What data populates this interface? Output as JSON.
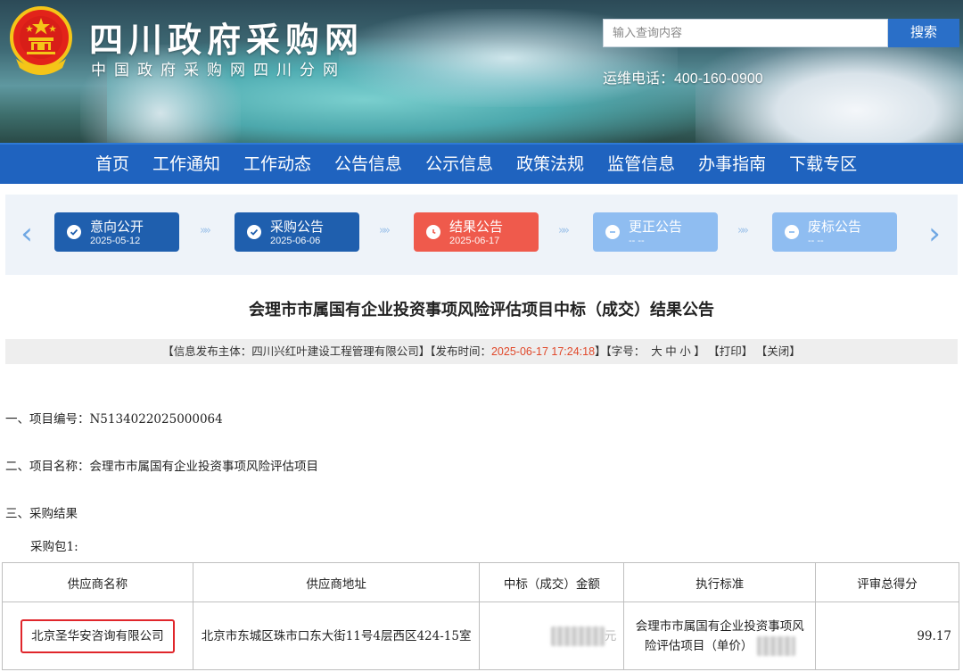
{
  "header": {
    "site_title": "四川政府采购网",
    "site_subtitle": "中国政府采购网四川分网",
    "search_placeholder": "输入查询内容",
    "search_button": "搜索",
    "hotline": "运维电话：400-160-0900"
  },
  "nav": {
    "items": [
      "首页",
      "工作通知",
      "工作动态",
      "公告信息",
      "公示信息",
      "政策法规",
      "监管信息",
      "办事指南",
      "下载专区"
    ]
  },
  "steps": [
    {
      "label": "意向公开",
      "date": "2025-05-12",
      "state": "done"
    },
    {
      "label": "采购公告",
      "date": "2025-06-06",
      "state": "done"
    },
    {
      "label": "结果公告",
      "date": "2025-06-17",
      "state": "current"
    },
    {
      "label": "更正公告",
      "date": "-- --",
      "state": "pending"
    },
    {
      "label": "废标公告",
      "date": "-- --",
      "state": "pending"
    }
  ],
  "document": {
    "title": "会理市市属国有企业投资事项风险评估项目中标（成交）结果公告",
    "meta": {
      "publisher_prefix": "【信息发布主体：四川兴红叶建设工程管理有限公司】【发布时间：",
      "publish_time": "2025-06-17 17:24:18",
      "font_prefix": "】【字号：",
      "font_large": "大",
      "font_medium": "中",
      "font_small": "小",
      "font_suffix": "】",
      "print": "【打印】",
      "close": "【关闭】"
    },
    "project_number": "一、项目编号：N5134022025000064",
    "project_name": "二、项目名称：会理市市属国有企业投资事项风险评估项目",
    "section3": "三、采购结果",
    "package": "采购包1:"
  },
  "table": {
    "headers": [
      "供应商名称",
      "供应商地址",
      "中标（成交）金额",
      "执行标准",
      "评审总得分"
    ],
    "rows": [
      {
        "supplier": "北京圣华安咨询有限公司",
        "address": "北京市东城区珠市口东大街11号4层西区424-15室",
        "amount": "元",
        "standard": "会理市市属国有企业投资事项风险评估项目（单价）",
        "score": "99.17"
      }
    ]
  },
  "colors": {
    "nav_blue": "#1f63bf",
    "step_done": "#1f5fae",
    "step_current": "#ef5a4c",
    "step_pending": "#8fbdf1",
    "highlight_red": "#e0262b",
    "time_red": "#e0482a"
  }
}
